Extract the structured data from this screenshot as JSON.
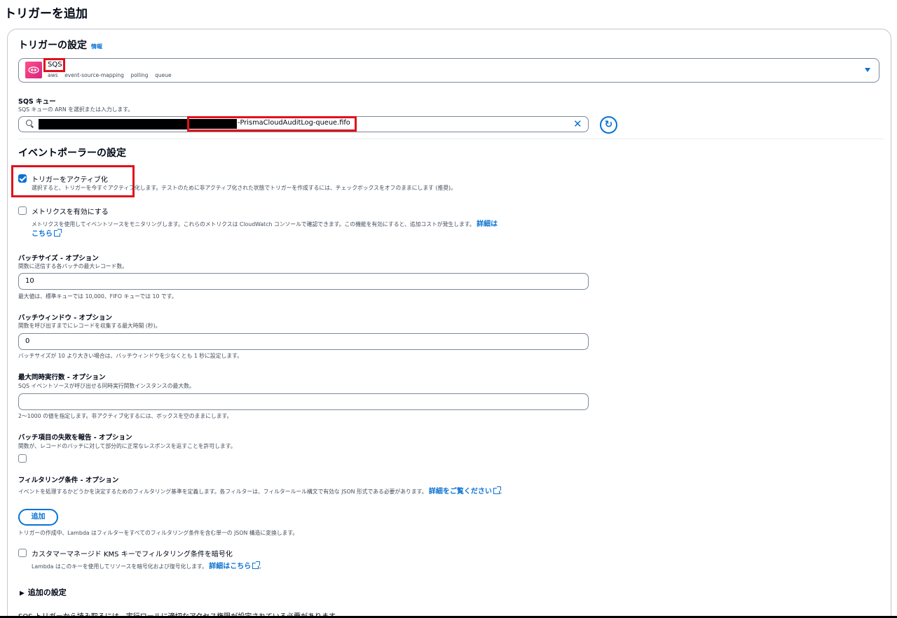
{
  "page_title": "トリガーを追加",
  "trigger_settings": {
    "heading": "トリガーの設定",
    "info_link": "情報",
    "source": {
      "name": "SQS",
      "tags": [
        "aws",
        "event-source-mapping",
        "polling",
        "queue"
      ]
    }
  },
  "sqs_queue": {
    "label": "SQS キュー",
    "description": "SQS キューの ARN を選択または入力します。",
    "value_suffix": "-PrismaCloudAuditLog-queue.fifo"
  },
  "event_poller": {
    "heading": "イベントポーラーの設定",
    "activate": {
      "label": "トリガーをアクティブ化",
      "description": "選択すると、トリガーを今すぐアクティブ化します。テストのために非アクティブ化された状態でトリガーを作成するには、チェックボックスをオフのままにします (推奨)。",
      "checked": true
    },
    "metrics": {
      "label": "メトリクスを有効にする",
      "description": "メトリクスを使用してイベントソースをモニタリングします。これらのメトリクスは CloudWatch コンソールで確認できます。この機能を有効にすると、追加コストが発生します。",
      "link1": "詳細は",
      "link2": "こちら",
      "checked": false
    }
  },
  "batch_size": {
    "label": "バッチサイズ - オプション",
    "description": "関数に送信する各バッチの最大レコード数。",
    "value": "10",
    "hint": "最大値は、標準キューでは 10,000、FIFO キューでは 10 です。"
  },
  "batch_window": {
    "label": "バッチウィンドウ - オプション",
    "description": "関数を呼び出すまでにレコードを収集する最大時間 (秒)。",
    "value": "0",
    "hint": "バッチサイズが 10 より大きい場合は、バッチウィンドウを少なくとも 1 秒に設定します。"
  },
  "max_concurrency": {
    "label": "最大同時実行数 - オプション",
    "description": "SQS イベントソースが呼び出せる同時実行関数インスタンスの最大数。",
    "value": "",
    "hint": "2〜1000 の値を指定します。非アクティブ化するには、ボックスを空のままにします。"
  },
  "report_failures": {
    "label": "バッチ項目の失敗を報告 - オプション",
    "description": "関数が、レコードのバッチに対して部分的に正常なレスポンスを返すことを許可します。",
    "checked": false
  },
  "filter": {
    "label": "フィルタリング条件 - オプション",
    "description": "イベントを処理するかどうかを決定するためのフィルタリング基準を定義します。各フィルターは、フィルタールール構文で有効な JSON 形式である必要があります。",
    "link": "詳細をご覧ください",
    "period": "。",
    "add_button": "追加",
    "hint": "トリガーの作成中、Lambda はフィルターをすべてのフィルタリング条件を含む単一の JSON 構造に変換します。"
  },
  "kms": {
    "label": "カスタマーマネージド KMS キーでフィルタリング条件を暗号化",
    "description": "Lambda はこのキーを使用してリソースを暗号化および復号化します。",
    "link": "詳細はこちら",
    "period": "。",
    "checked": false
  },
  "additional_settings": {
    "label": "追加の設定"
  },
  "footer_note": "SQS トリガーから読み取るには、実行ロールに適切なアクセス権限が設定されている必要があります。",
  "colors": {
    "accent": "#0972d3",
    "highlight_red": "#e0111b",
    "sqs_pink": "#e7157b"
  }
}
